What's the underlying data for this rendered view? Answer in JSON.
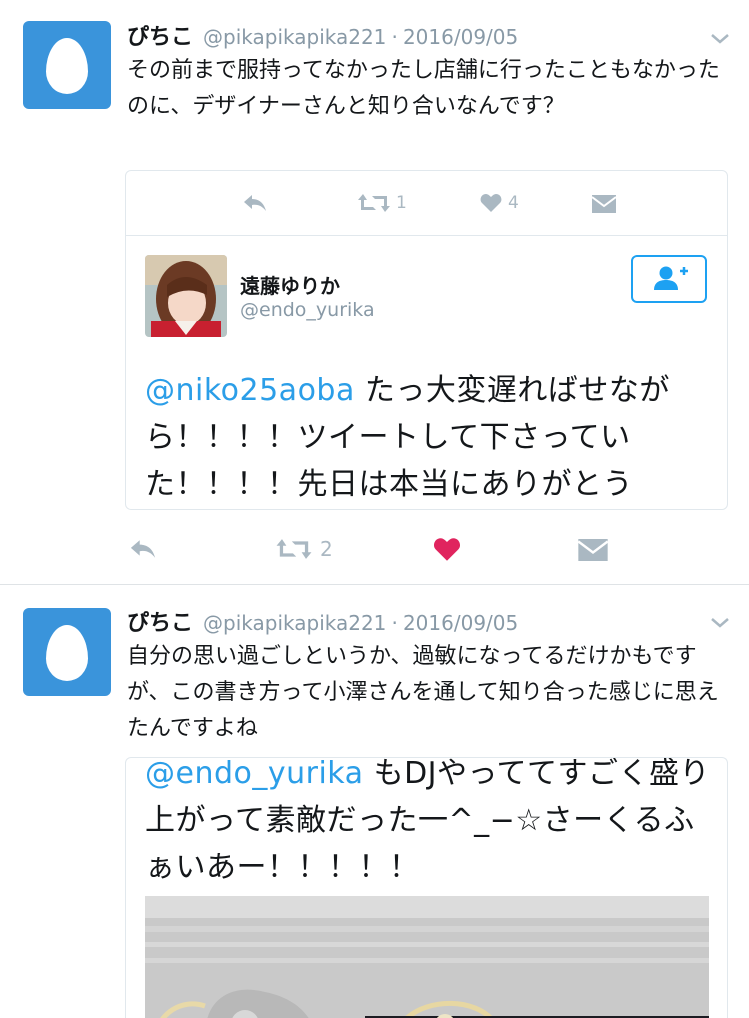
{
  "tweets": [
    {
      "name": "ぴちこ",
      "handle": "@pikapikapika221",
      "sep": "·",
      "date": "2016/09/05",
      "text": "その前まで服持ってなかったし店舗に行ったこともなかったのに、デザイナーさんと知り合いなんです？",
      "quoted": {
        "retweet_count": "1",
        "like_count": "4",
        "name": "遠藤ゆりか",
        "handle": "@endo_yurika",
        "mention": "@niko25aoba",
        "text": " たっ大変遅ればせながら！！！！ツイートして下さっていた！！！！先日は本当にありがとう"
      },
      "retweet_count": "2",
      "liked": true
    },
    {
      "name": "ぴちこ",
      "handle": "@pikapikapika221",
      "sep": "·",
      "date": "2016/09/05",
      "text": "自分の思い過ごしというか、過敏になってるだけかもですが、この書き方って小澤さんを通して知り合った感じに思えたんですよね",
      "quoted": {
        "mention": "@endo_yurika",
        "text": " もDJやっててすごく盛り上がって素敵だった一^_−☆さーくるふぁいあー！！！！！"
      }
    }
  ],
  "colors": {
    "accent": "#1da1f2",
    "mention": "#2b9ee8",
    "like": "#e0245e",
    "muted": "#aab8c2",
    "avatar_bg": "#3a94db"
  },
  "icons": [
    "egg-avatar-icon",
    "chevron-down-icon",
    "reply-icon",
    "retweet-icon",
    "heart-icon",
    "dm-icon",
    "follow-icon"
  ]
}
